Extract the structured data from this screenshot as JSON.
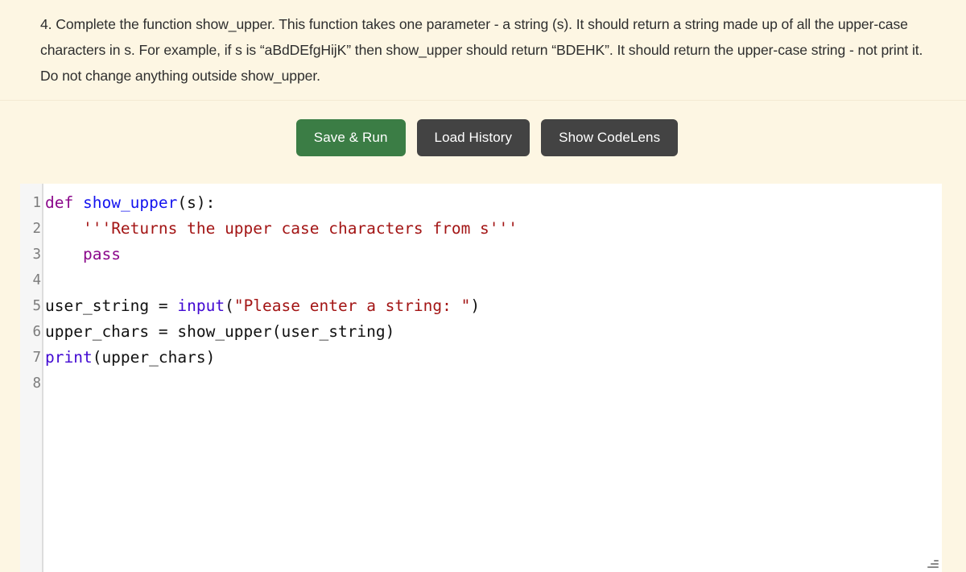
{
  "question": {
    "text": "4. Complete the function show_upper. This function takes one parameter - a string (s). It should return a string made up of all the upper-case characters in s. For example, if s is “aBdDEfgHijK” then show_upper should return “BDEHK”. It should return the upper-case string - not print it. Do not change anything outside show_upper."
  },
  "toolbar": {
    "save_run_label": "Save & Run",
    "load_history_label": "Load History",
    "show_codelens_label": "Show CodeLens",
    "colors": {
      "save_run_bg": "#3b7d45",
      "dark_bg": "#434343",
      "button_text": "#ffffff"
    }
  },
  "editor": {
    "language": "python",
    "background": "#ffffff",
    "gutter_background": "#f6f6f6",
    "line_numbers": [
      "1",
      "2",
      "3",
      "4",
      "5",
      "6",
      "7",
      "8"
    ],
    "lines": [
      {
        "number": "1",
        "plain": "def show_upper(s):",
        "tokens": [
          {
            "t": "def",
            "c": "tok-kw"
          },
          {
            "t": " ",
            "c": "tok-plain"
          },
          {
            "t": "show_upper",
            "c": "tok-fn"
          },
          {
            "t": "(s):",
            "c": "tok-punc"
          }
        ]
      },
      {
        "number": "2",
        "plain": "    '''Returns the upper case characters from s'''",
        "tokens": [
          {
            "t": "    ",
            "c": "tok-plain"
          },
          {
            "t": "'''Returns the upper case characters from s'''",
            "c": "tok-str"
          }
        ]
      },
      {
        "number": "3",
        "plain": "    pass",
        "tokens": [
          {
            "t": "    ",
            "c": "tok-plain"
          },
          {
            "t": "pass",
            "c": "tok-kw"
          }
        ]
      },
      {
        "number": "4",
        "plain": "",
        "tokens": []
      },
      {
        "number": "5",
        "plain": "user_string = input(\"Please enter a string: \")",
        "tokens": [
          {
            "t": "user_string = ",
            "c": "tok-plain"
          },
          {
            "t": "input",
            "c": "tok-bi"
          },
          {
            "t": "(",
            "c": "tok-punc"
          },
          {
            "t": "\"Please enter a string: \"",
            "c": "tok-str"
          },
          {
            "t": ")",
            "c": "tok-punc"
          }
        ]
      },
      {
        "number": "6",
        "plain": "upper_chars = show_upper(user_string)",
        "tokens": [
          {
            "t": "upper_chars = show_upper(user_string)",
            "c": "tok-plain"
          }
        ]
      },
      {
        "number": "7",
        "plain": "print(upper_chars)",
        "tokens": [
          {
            "t": "print",
            "c": "tok-bi"
          },
          {
            "t": "(upper_chars)",
            "c": "tok-punc"
          }
        ]
      },
      {
        "number": "8",
        "plain": "",
        "tokens": []
      }
    ]
  },
  "resize_handle": {
    "name": "resize-grip"
  }
}
